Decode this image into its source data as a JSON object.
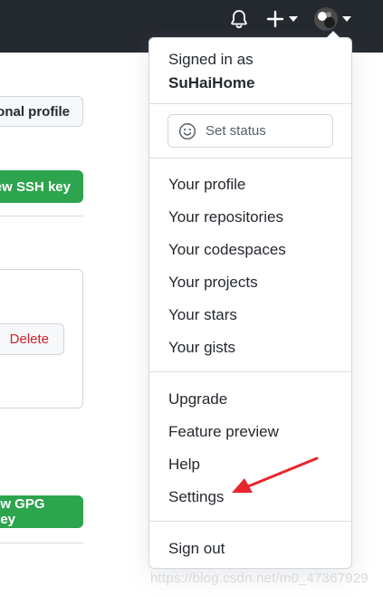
{
  "header": {
    "icons": [
      "bell-icon",
      "plus-icon",
      "avatar"
    ]
  },
  "background_page": {
    "profile_button": "onal profile",
    "new_ssh_button": "ew SSH key",
    "delete_button": "Delete",
    "new_gpg_button": "ew GPG key"
  },
  "dropdown": {
    "signed_in_label": "Signed in as",
    "username": "SuHaiHome",
    "set_status": "Set status",
    "section1": [
      "Your profile",
      "Your repositories",
      "Your codespaces",
      "Your projects",
      "Your stars",
      "Your gists"
    ],
    "section2": [
      "Upgrade",
      "Feature preview",
      "Help",
      "Settings"
    ],
    "sign_out": "Sign out"
  },
  "watermark": "https://blog.csdn.net/m0_47367929",
  "colors": {
    "header_bg": "#24292f",
    "primary_green": "#2da44e",
    "danger_red": "#cf222e",
    "annotation_red": "#e8262d"
  }
}
